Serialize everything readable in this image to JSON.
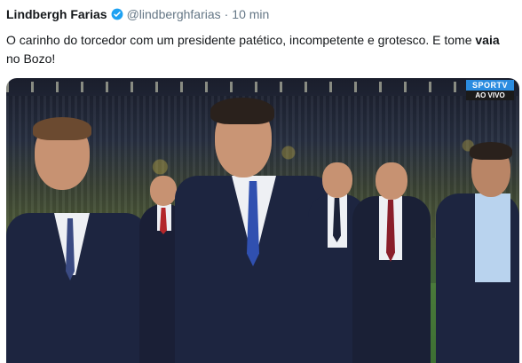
{
  "tweet": {
    "author_name": "Lindbergh Farias",
    "author_handle": "@lindberghfarias",
    "separator": "·",
    "timestamp": "10 min",
    "text_part1": "O carinho do torcedor com um presidente patético, incompetente e grotesco. E tome ",
    "text_bold": "vaia",
    "text_part2": " no Bozo!"
  },
  "video": {
    "channel_logo": "SPORTV",
    "live_label": "AO VIVO"
  },
  "colors": {
    "verified_badge": "#1da1f2",
    "channel_blue": "#2b8ce0"
  }
}
